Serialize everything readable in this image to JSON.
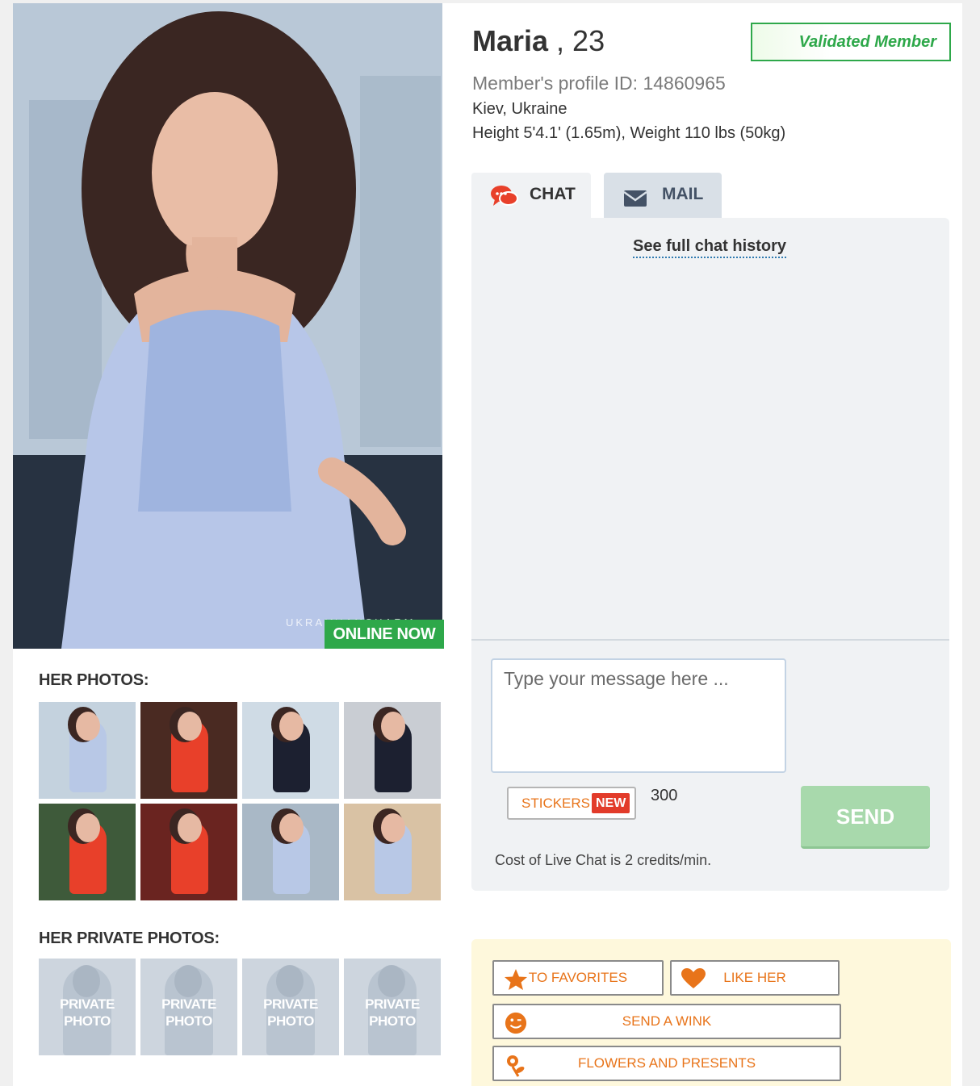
{
  "profile": {
    "name": "Maria",
    "age_text": " , 23",
    "validated_label": "Validated Member",
    "profile_id": "Member's profile ID: 14860965",
    "location": "Kiev, Ukraine",
    "height_weight": "Height 5'4.1' (1.65m), Weight 110 lbs (50kg)",
    "online_label": "ONLINE NOW",
    "watermark": "UKRAINIANCHARM"
  },
  "photos": {
    "title": "HER PHOTOS:",
    "count": 8,
    "dress_colors": [
      "#b8c8e6",
      "#e8402a",
      "#1c2030",
      "#1c2030",
      "#e8402a",
      "#e8402a",
      "#b8c8e6",
      "#b8c8e6"
    ],
    "backgrounds": [
      "#c4d2de",
      "#4a2a22",
      "#cfdbe5",
      "#c9cdd3",
      "#3e5a3a",
      "#6a2420",
      "#a9b8c6",
      "#d9c2a4"
    ]
  },
  "private_photos": {
    "title": "HER PRIVATE PHOTOS:",
    "label_line1": "PRIVATE",
    "label_line2": "PHOTO",
    "count": 4
  },
  "tabs": {
    "chat": "CHAT",
    "mail": "MAIL"
  },
  "chat": {
    "history_link": "See full chat history",
    "placeholder": "Type your message here ...",
    "stickers_label": "STICKERS",
    "new_badge": "NEW",
    "char_count": "300",
    "send_label": "SEND",
    "cost_text": "Cost of Live Chat is 2 credits/min."
  },
  "actions": {
    "favorites": "TO FAVORITES",
    "like": "LIKE HER",
    "wink": "SEND A WINK",
    "flowers": "FLOWERS AND PRESENTS"
  },
  "colors": {
    "accent_green": "#2ea84a",
    "accent_orange": "#e8741a",
    "send_disabled": "#a8d9ac",
    "new_red": "#e23b2a"
  },
  "icons": {
    "chat_tab": "chat-bubbles-icon",
    "mail_tab": "envelope-icon",
    "favorites": "star-icon",
    "like": "heart-icon",
    "wink": "smiley-icon",
    "flowers": "flower-icon"
  }
}
